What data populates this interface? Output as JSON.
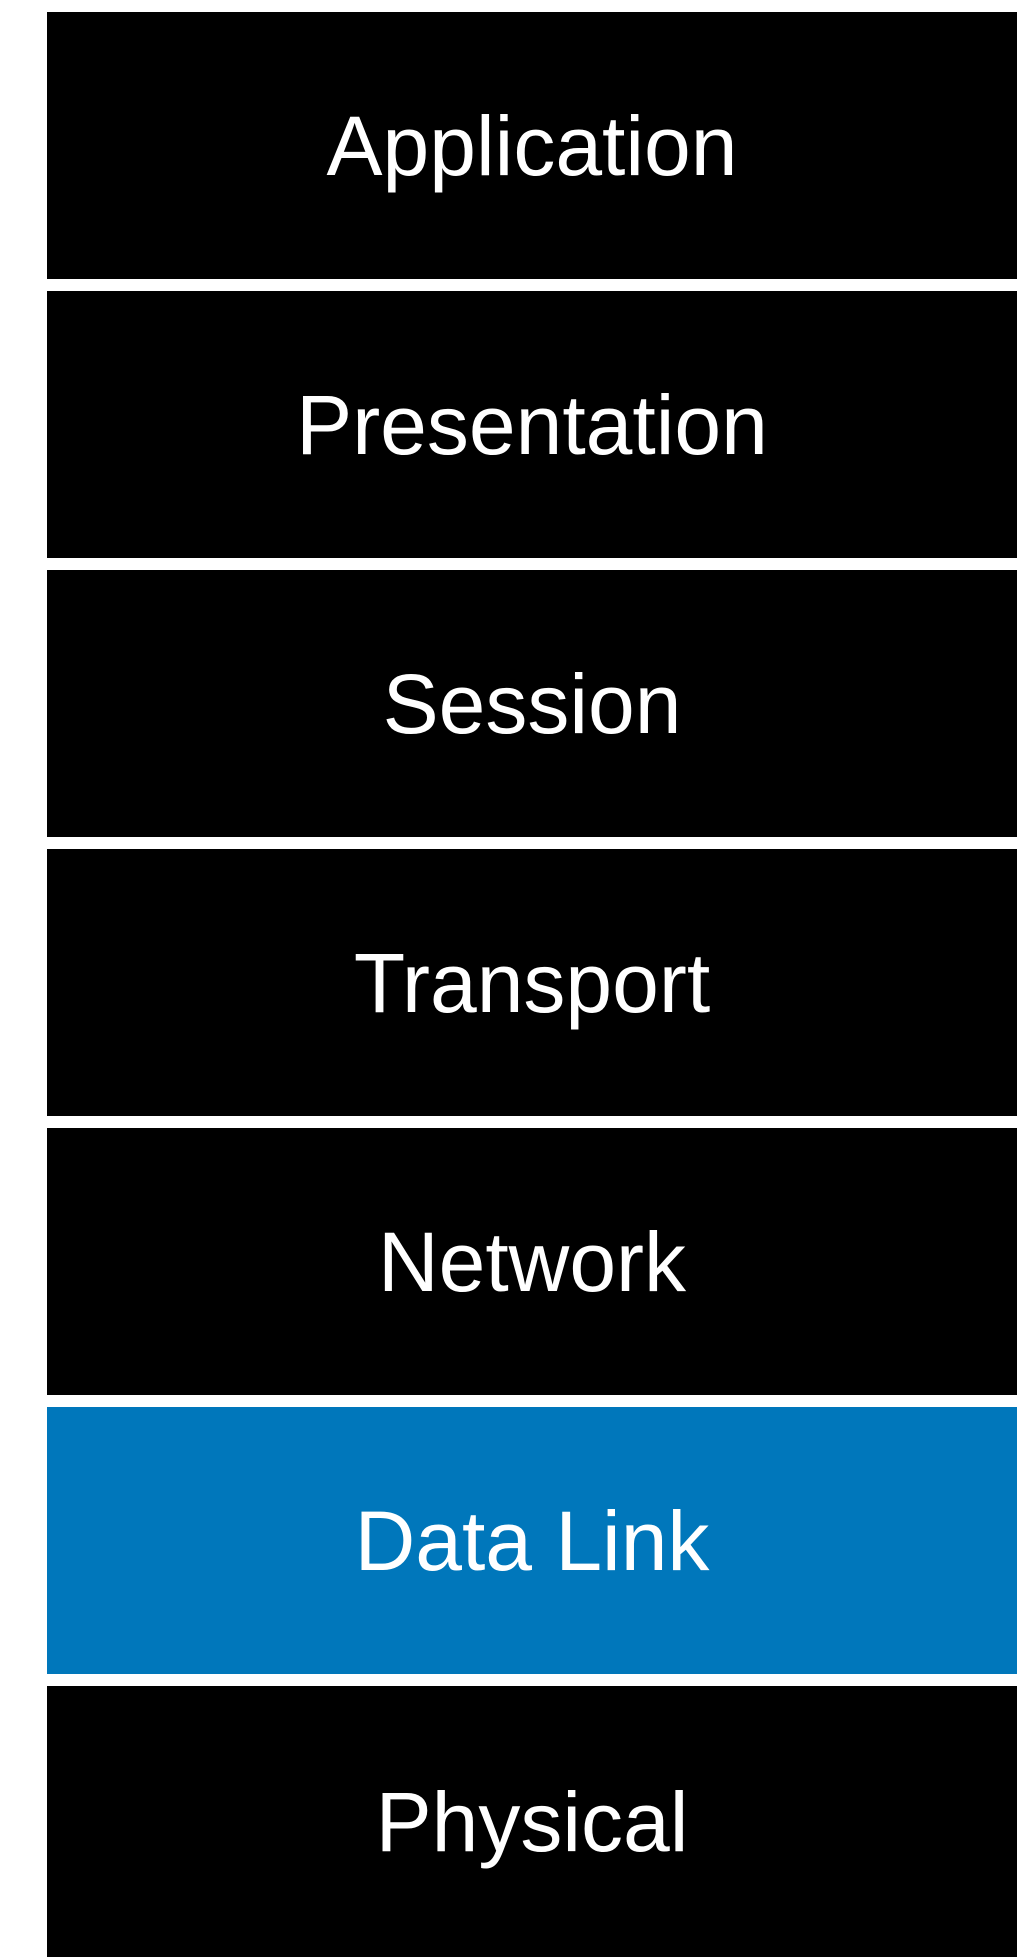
{
  "diagram": {
    "layers": [
      {
        "label": "Application",
        "color": "#000000",
        "highlighted": false
      },
      {
        "label": "Presentation",
        "color": "#000000",
        "highlighted": false
      },
      {
        "label": "Session",
        "color": "#000000",
        "highlighted": false
      },
      {
        "label": "Transport",
        "color": "#000000",
        "highlighted": false
      },
      {
        "label": "Network",
        "color": "#000000",
        "highlighted": false
      },
      {
        "label": "Data Link",
        "color": "#0077BB",
        "highlighted": true
      },
      {
        "label": "Physical",
        "color": "#000000",
        "highlighted": false
      }
    ],
    "text_color": "#FFFFFF"
  }
}
